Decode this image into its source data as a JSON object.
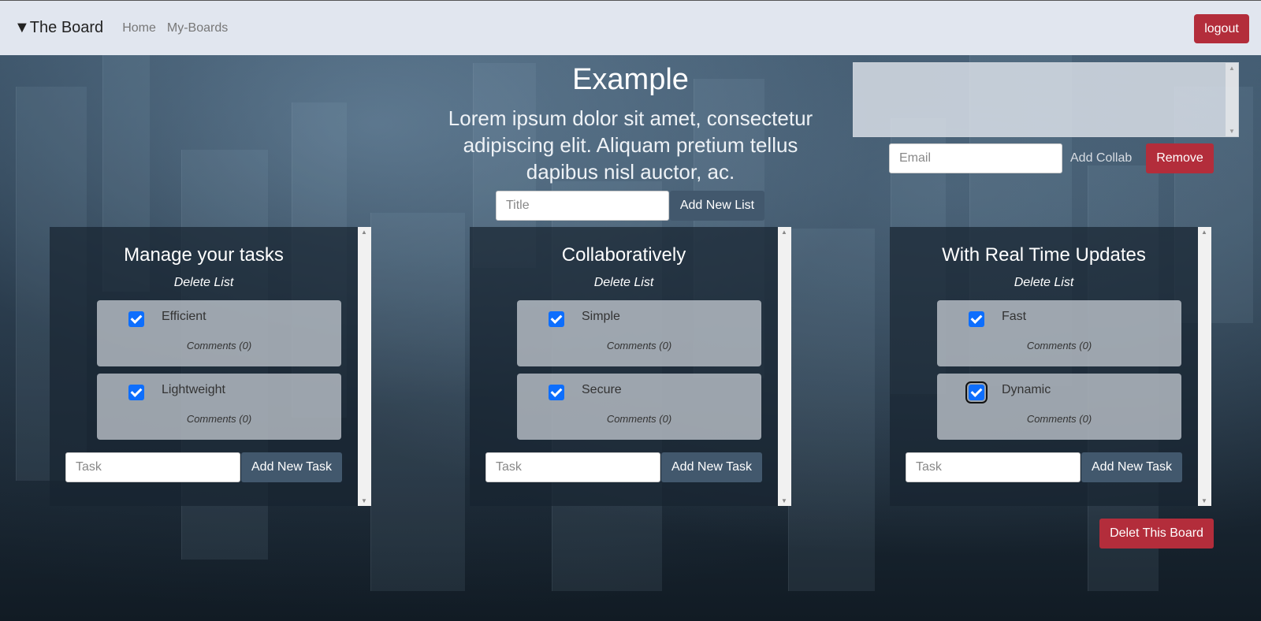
{
  "navbar": {
    "brand": "▼The Board",
    "links": [
      "Home",
      "My-Boards"
    ],
    "logout_label": "logout"
  },
  "board": {
    "title": "Example",
    "description": "Lorem ipsum dolor sit amet, consectetur adipiscing elit. Aliquam pretium tellus dapibus nisl auctor, ac.",
    "title_placeholder": "Title",
    "add_list_label": "Add New List",
    "delete_board_label": "Delet This Board"
  },
  "collab": {
    "email_placeholder": "Email",
    "add_label": "Add Collab",
    "remove_label": "Remove"
  },
  "lists": [
    {
      "title": "Manage your tasks",
      "delete_label": "Delete List",
      "tasks": [
        {
          "name": "Efficient",
          "checked": true,
          "comments": "Comments (0)"
        },
        {
          "name": "Lightweight",
          "checked": true,
          "comments": "Comments (0)"
        }
      ],
      "task_placeholder": "Task",
      "add_task_label": "Add New Task"
    },
    {
      "title": "Collaboratively",
      "delete_label": "Delete List",
      "tasks": [
        {
          "name": "Simple",
          "checked": true,
          "comments": "Comments (0)"
        },
        {
          "name": "Secure",
          "checked": true,
          "comments": "Comments (0)"
        }
      ],
      "task_placeholder": "Task",
      "add_task_label": "Add New Task"
    },
    {
      "title": "With Real Time Updates",
      "delete_label": "Delete List",
      "tasks": [
        {
          "name": "Fast",
          "checked": true,
          "comments": "Comments (0)"
        },
        {
          "name": "Dynamic",
          "checked": true,
          "comments": "Comments (0)"
        }
      ],
      "task_placeholder": "Task",
      "add_task_label": "Add New Task"
    }
  ],
  "colors": {
    "navbar_bg": "#e1e6ef",
    "danger": "#b32d3b",
    "slate_button": "#42586d",
    "checkbox": "#0d6efd"
  }
}
